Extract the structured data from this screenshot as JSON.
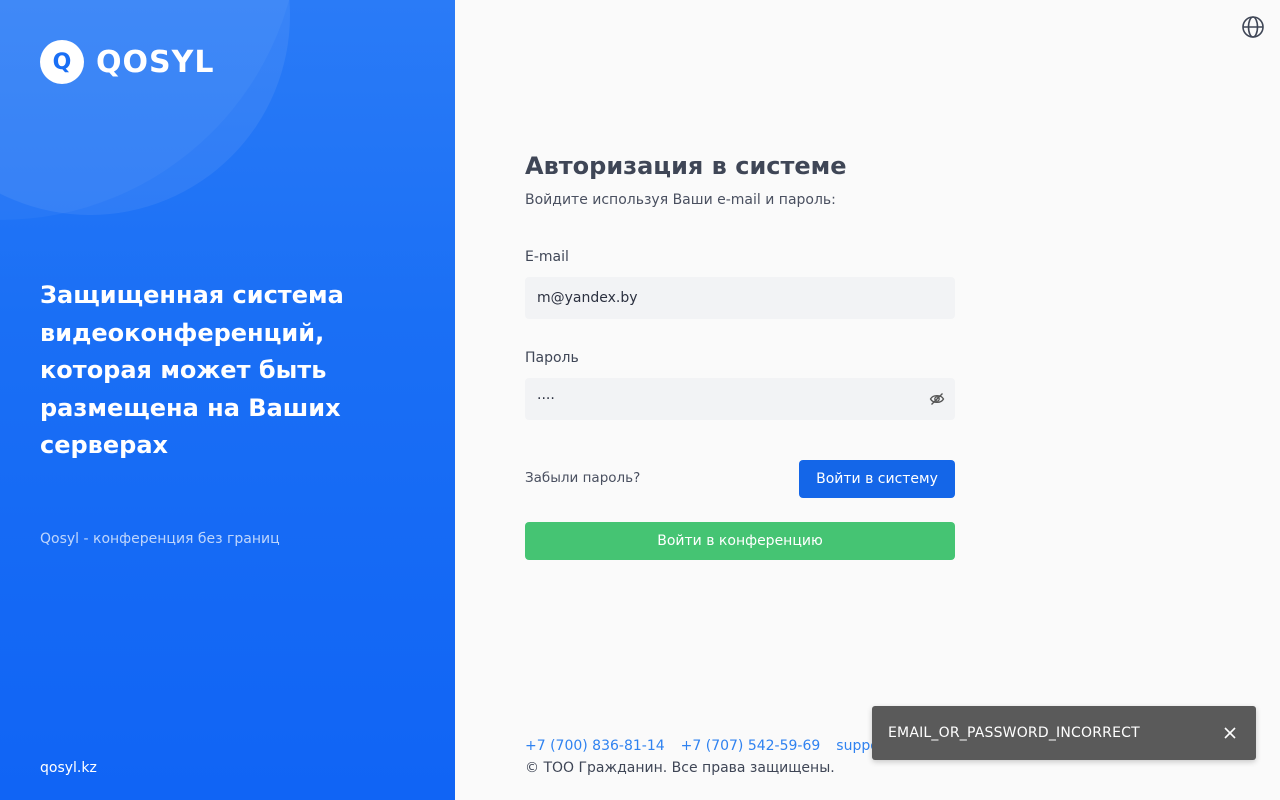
{
  "brand": {
    "logo_letter": "Q",
    "name": "QOSYL"
  },
  "hero": {
    "tagline": "Защищенная система видеоконференций, которая может быть размещена на Ваших серверах",
    "slogan": "Qosyl - конференция без границ",
    "site": "qosyl.kz"
  },
  "header": {
    "language_icon": "globe-icon"
  },
  "form": {
    "title": "Авторизация в системе",
    "subtitle": "Войдите используя Ваши e-mail и пароль:",
    "email_label": "E-mail",
    "email_value": "m@yandex.by",
    "password_label": "Пароль",
    "password_value": "····",
    "forgot_label": "Забыли пароль?",
    "login_button": "Войти в систему",
    "conference_button": "Войти в конференцию"
  },
  "footer": {
    "phone1": "+7 (700) 836-81-14",
    "phone2": "+7 (707) 542-59-69",
    "email": "support@qosyl.kz",
    "copyright": "© ТОО Гражданин. Все права защищены."
  },
  "toast": {
    "message": "EMAIL_OR_PASSWORD_INCORRECT",
    "close_icon": "close-icon"
  },
  "colors": {
    "primary": "#1466e8",
    "success": "#45c473",
    "panel": "#1a6ff5",
    "toast_bg": "#5a5a5a"
  }
}
